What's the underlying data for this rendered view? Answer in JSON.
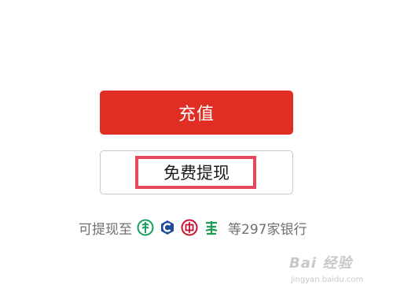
{
  "buttons": {
    "recharge_label": "充值",
    "withdraw_label": "免费提现"
  },
  "banks": {
    "lead_text": "可提现至",
    "icons": [
      "agricultural-bank-icon",
      "communications-bank-icon",
      "china-bank-icon",
      "construction-bank-icon"
    ],
    "tail_text": "等297家银行"
  },
  "watermark": {
    "logo_text": "Bai 经验",
    "url_text": "jingyan.baidu.com"
  },
  "colors": {
    "primary_red": "#e02e24",
    "highlight_pink": "#e5475b",
    "text_gray": "#707070",
    "abc_green": "#17a05d",
    "bocom_blue": "#1f4a9c",
    "boc_red": "#c8102e",
    "ccb_green": "#1f9d55"
  }
}
